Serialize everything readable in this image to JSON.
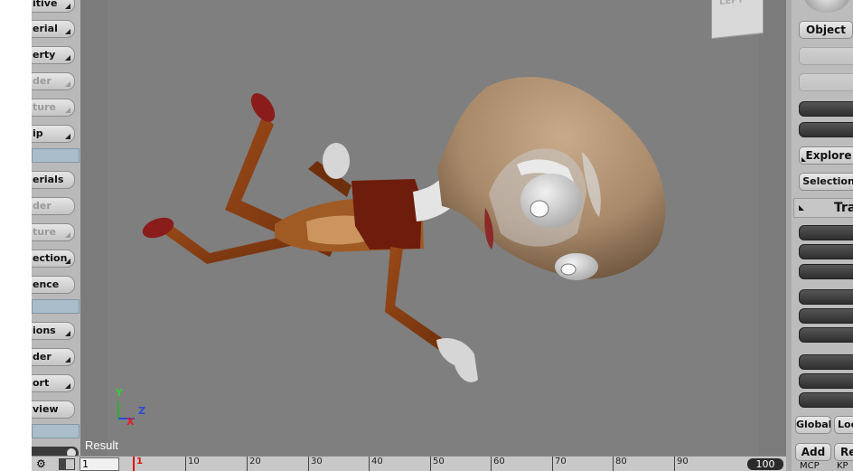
{
  "left_toolbar": {
    "buttons": [
      {
        "label": "itive",
        "disabled": false,
        "has_arrow": true
      },
      {
        "label": "erial",
        "disabled": false,
        "has_arrow": true
      },
      {
        "label": "erty",
        "disabled": false,
        "has_arrow": true
      },
      {
        "label": "der",
        "disabled": true,
        "has_arrow": true
      },
      {
        "label": "ture",
        "disabled": true,
        "has_arrow": true
      },
      {
        "label": "ip",
        "disabled": false,
        "has_arrow": true
      },
      {
        "label": "erials",
        "disabled": false,
        "has_arrow": false
      },
      {
        "label": "der",
        "disabled": true,
        "has_arrow": false
      },
      {
        "label": "ture",
        "disabled": true,
        "has_arrow": true
      },
      {
        "label": "ection",
        "disabled": false,
        "has_arrow": true
      },
      {
        "label": "ence",
        "disabled": false,
        "has_arrow": false
      },
      {
        "label": "ions",
        "disabled": false,
        "has_arrow": true
      },
      {
        "label": "der",
        "disabled": false,
        "has_arrow": true
      },
      {
        "label": "ort",
        "disabled": false,
        "has_arrow": true
      },
      {
        "label": "view",
        "disabled": false,
        "has_arrow": false
      }
    ]
  },
  "viewport": {
    "label": "Result",
    "nav_cube_label": "LEFT",
    "axis": {
      "y": "Y",
      "z": "Z",
      "x": "X"
    }
  },
  "timeline": {
    "frame_field": "1",
    "current_marker": "1",
    "ticks": [
      "10",
      "20",
      "30",
      "40",
      "50",
      "60",
      "70",
      "80",
      "90"
    ],
    "end_frame": "100"
  },
  "right_panel": {
    "object_button": "Object",
    "explore_button": "Explore",
    "selection_button": "Selection",
    "transform_header": "Tra",
    "global_button": "Global",
    "local_button": "Loc",
    "add_button": "Add",
    "re_button": "Re",
    "mcp_label": "MCP",
    "kp_label": "KP"
  },
  "colors": {
    "viewport_bg": "#7f7f7f",
    "toolbar_bg": "#b9b9b9",
    "separator": "#a9bdca",
    "current_frame_marker": "#dd1111"
  }
}
